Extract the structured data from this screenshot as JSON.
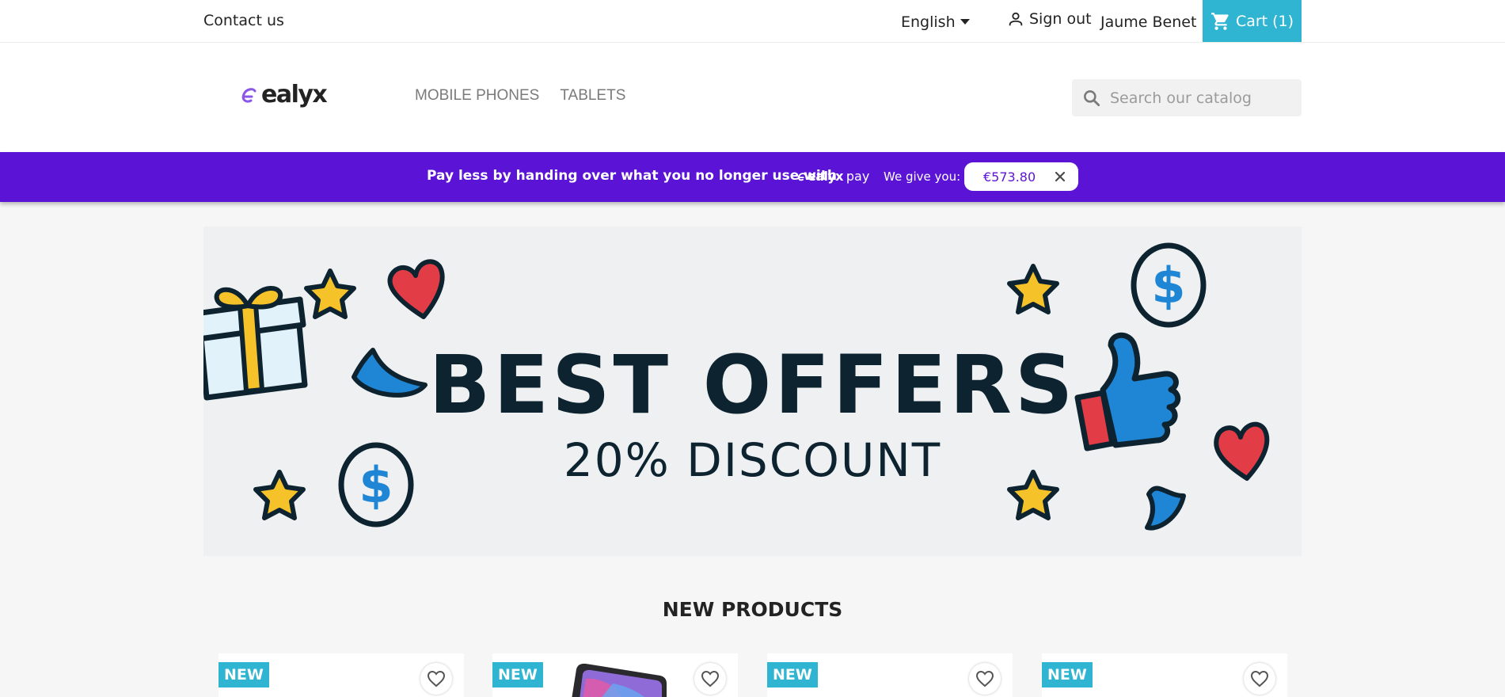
{
  "topnav": {
    "contact": "Contact us",
    "language": "English",
    "signout": "Sign out",
    "username": "Jaume Benet",
    "cart": "Cart (1)"
  },
  "header": {
    "logo": "ealyx",
    "menu": [
      "MOBILE PHONES",
      "TABLETS"
    ],
    "search_placeholder": "Search our catalog"
  },
  "promo": {
    "text": "Pay less by handing over what you no longer use with",
    "brand": "ealyx",
    "brand_suffix": "pay",
    "give_label": "We give you:",
    "amount": "€573.80"
  },
  "hero": {
    "title": "BEST OFFERS",
    "subtitle": "20% DISCOUNT"
  },
  "new_products": {
    "title": "NEW PRODUCTS",
    "badge": "NEW"
  },
  "colors": {
    "accent": "#2fb5d2",
    "promo": "#5b14d6",
    "hero_text": "#0d2330"
  }
}
